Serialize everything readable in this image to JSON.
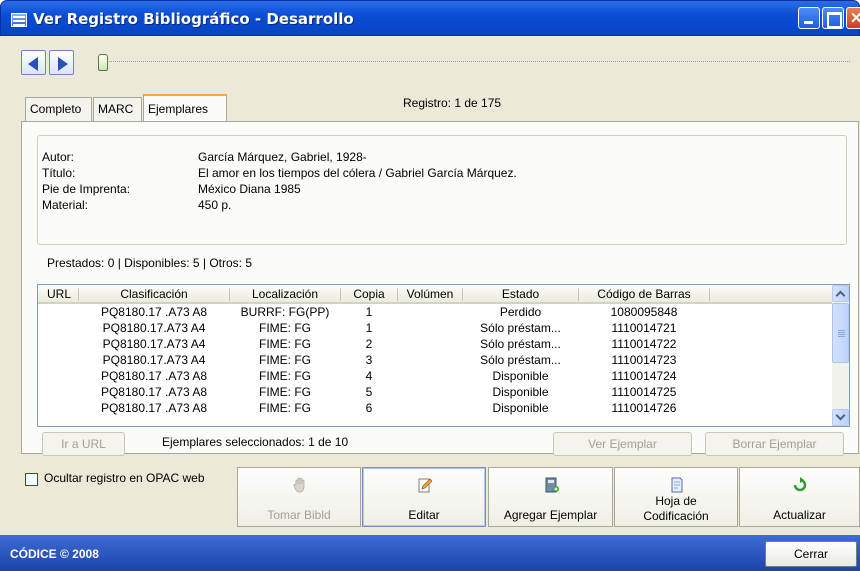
{
  "window": {
    "title": "Ver Registro Bibliográfico - Desarrollo"
  },
  "tabs": [
    {
      "label": "Completo"
    },
    {
      "label": "MARC"
    },
    {
      "label": "Ejemplares"
    }
  ],
  "record_position": "Registro: 1 de 175",
  "record": {
    "labels": {
      "author": "Autor:",
      "title": "Título:",
      "imprint": "Pie de Imprenta:",
      "material": "Material:"
    },
    "author": "García Márquez, Gabriel, 1928-",
    "title": "El amor en los tiempos del cólera / Gabriel García Márquez.",
    "imprint": "México Diana 1985",
    "material": "450 p."
  },
  "summary": "Prestados: 0 | Disponibles: 5 | Otros: 5",
  "table": {
    "headers": [
      "URL",
      "Clasificación",
      "Localización",
      "Copia",
      "Volúmen",
      "Estado",
      "Código de Barras"
    ],
    "rows": [
      [
        "",
        "PQ8180.17 .A73 A8",
        "BURRF: FG(PP)",
        "1",
        "",
        "Perdido",
        "1080095848"
      ],
      [
        "",
        "PQ8180.17.A73 A4",
        "FIME: FG",
        "1",
        "",
        "Sólo préstam...",
        "1110014721"
      ],
      [
        "",
        "PQ8180.17.A73 A4",
        "FIME: FG",
        "2",
        "",
        "Sólo préstam...",
        "1110014722"
      ],
      [
        "",
        "PQ8180.17.A73 A4",
        "FIME: FG",
        "3",
        "",
        "Sólo préstam...",
        "1110014723"
      ],
      [
        "",
        "PQ8180.17 .A73 A8",
        "FIME: FG",
        "4",
        "",
        "Disponible",
        "1110014724"
      ],
      [
        "",
        "PQ8180.17 .A73 A8",
        "FIME: FG",
        "5",
        "",
        "Disponible",
        "1110014725"
      ],
      [
        "",
        "PQ8180.17 .A73 A8",
        "FIME: FG",
        "6",
        "",
        "Disponible",
        "1110014726"
      ]
    ]
  },
  "buttons": {
    "ir_url": "Ir a URL",
    "ver_ejemplar": "Ver Ejemplar",
    "borrar_ejemplar": "Borrar Ejemplar"
  },
  "selected_text": "Ejemplares seleccionados: 1 de 10",
  "hide_opac": "Ocultar registro en OPAC web",
  "actions": [
    {
      "label": "Tomar Bibld",
      "icon": "hand-icon",
      "enabled": false
    },
    {
      "label": "Editar",
      "icon": "edit-pencil-icon",
      "enabled": true
    },
    {
      "label": "Agregar Ejemplar",
      "icon": "add-copy-icon",
      "enabled": true
    },
    {
      "label": "Hoja de Codificación",
      "icon": "coding-sheet-icon",
      "enabled": true
    },
    {
      "label": "Actualizar",
      "icon": "refresh-icon",
      "enabled": true
    }
  ],
  "footer": {
    "copyright": "CÓDICE © 2008",
    "close_label": "Cerrar"
  }
}
